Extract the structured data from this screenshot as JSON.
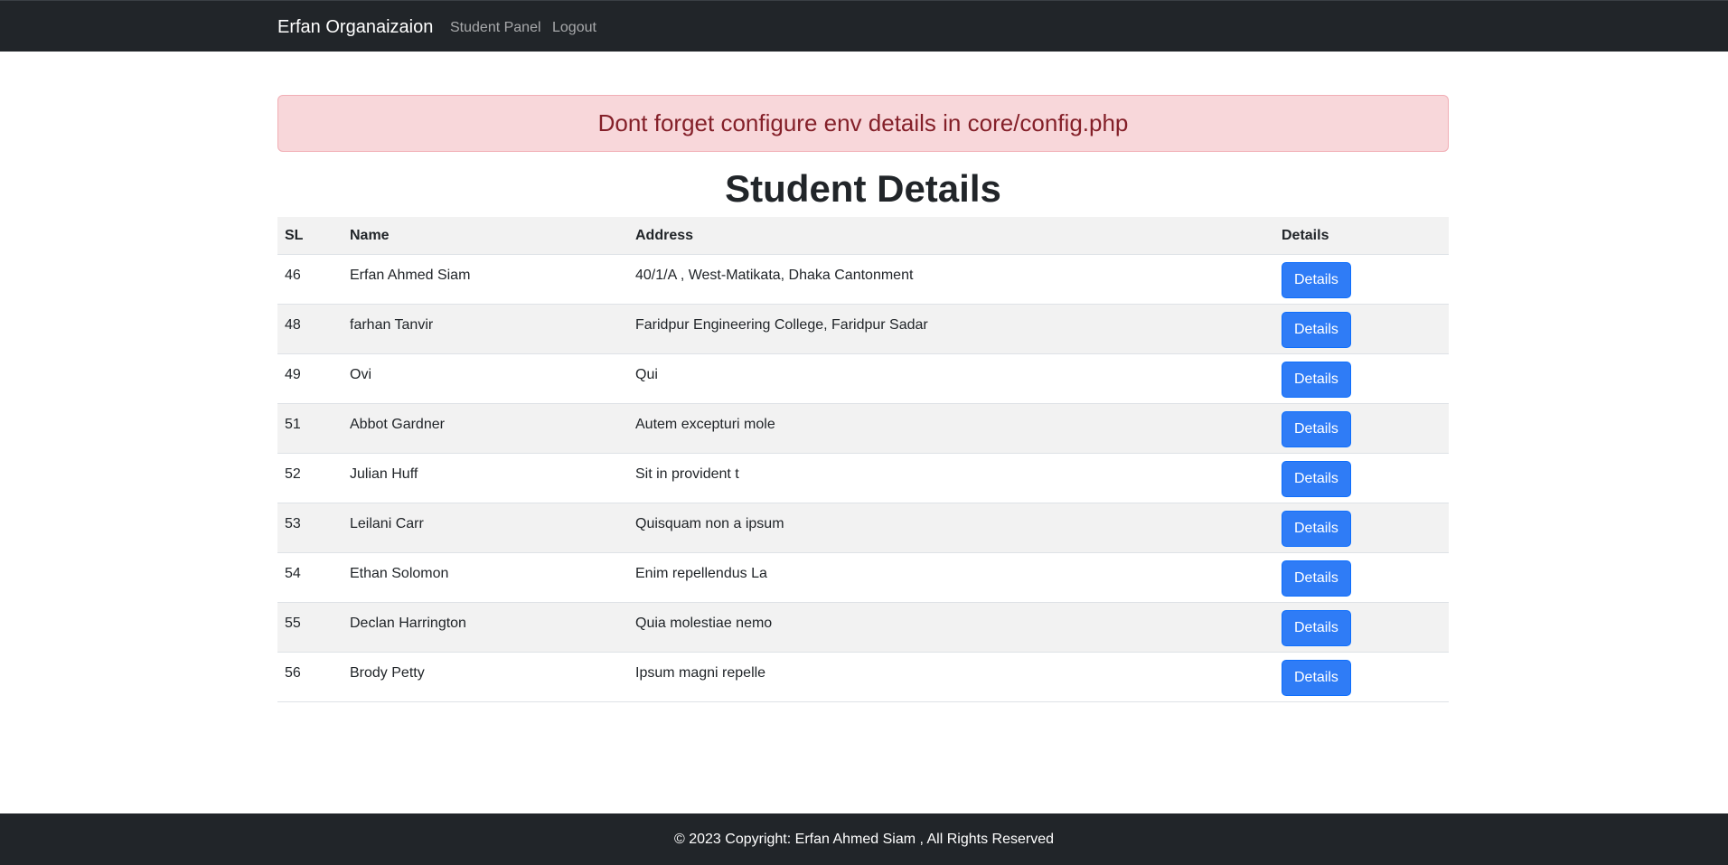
{
  "navbar": {
    "brand": "Erfan Organaizaion",
    "links": [
      {
        "label": "Student Panel"
      },
      {
        "label": "Logout"
      }
    ]
  },
  "alert": {
    "message": "Dont forget configure env details in core/config.php"
  },
  "page": {
    "title": "Student Details"
  },
  "table": {
    "columns": [
      "SL",
      "Name",
      "Address",
      "Details"
    ],
    "rows": [
      {
        "sl": "46",
        "name": "Erfan Ahmed Siam",
        "address": "40/1/A , West-Matikata, Dhaka Cantonment",
        "button": "Details"
      },
      {
        "sl": "48",
        "name": "farhan Tanvir",
        "address": "Faridpur Engineering College, Faridpur Sadar",
        "button": "Details"
      },
      {
        "sl": "49",
        "name": "Ovi",
        "address": "Qui",
        "button": "Details"
      },
      {
        "sl": "51",
        "name": "Abbot Gardner",
        "address": "Autem excepturi mole",
        "button": "Details"
      },
      {
        "sl": "52",
        "name": "Julian Huff",
        "address": "Sit in provident t",
        "button": "Details"
      },
      {
        "sl": "53",
        "name": "Leilani Carr",
        "address": "Quisquam non a ipsum",
        "button": "Details"
      },
      {
        "sl": "54",
        "name": "Ethan Solomon",
        "address": "Enim repellendus La",
        "button": "Details"
      },
      {
        "sl": "55",
        "name": "Declan Harrington",
        "address": "Quia molestiae nemo",
        "button": "Details"
      },
      {
        "sl": "56",
        "name": "Brody Petty",
        "address": "Ipsum magni repelle",
        "button": "Details"
      }
    ]
  },
  "footer": {
    "text": "© 2023 Copyright: Erfan Ahmed Siam , All Rights Reserved"
  },
  "colors": {
    "navbar_bg": "#212529",
    "alert_bg": "#f8d7da",
    "alert_text": "#842029",
    "button_bg": "#2f7cf6",
    "footer_bg": "#212529"
  }
}
